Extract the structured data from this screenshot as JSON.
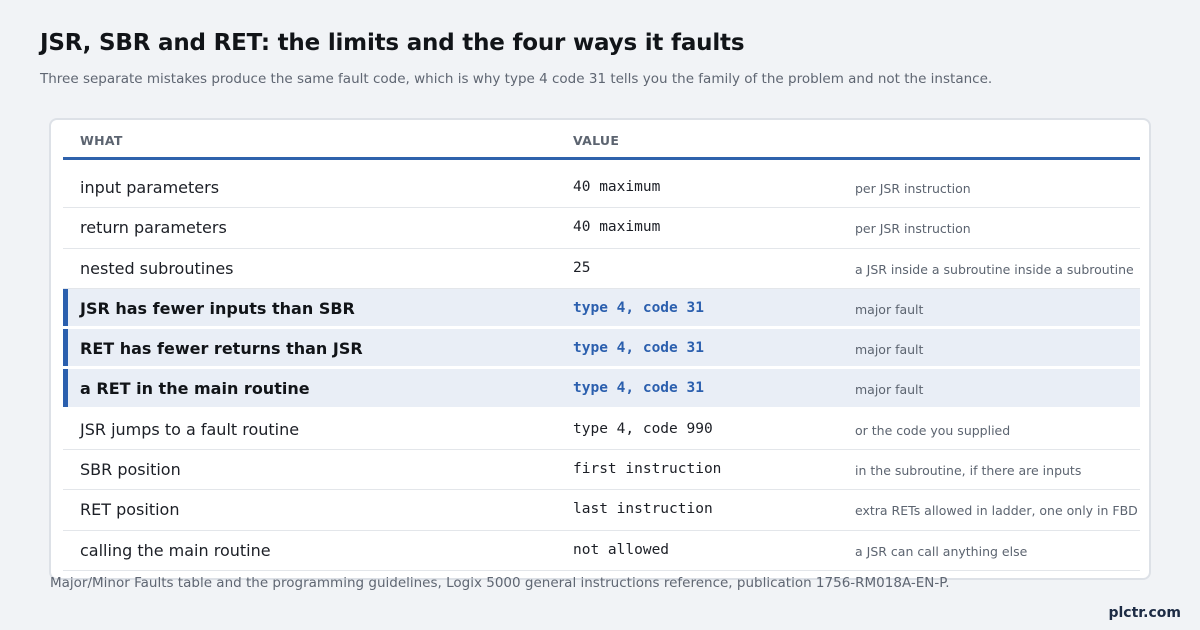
{
  "header": {
    "title": "JSR, SBR and RET: the limits and the four ways it faults",
    "subtitle": "Three separate mistakes produce the same fault code, which is why type 4 code 31 tells you the family of the problem and not the instance."
  },
  "table": {
    "columns": {
      "what": "WHAT",
      "value": "VALUE"
    },
    "rows": [
      {
        "what": "input parameters",
        "value": "40 maximum",
        "note": "per JSR instruction",
        "highlight": false
      },
      {
        "what": "return parameters",
        "value": "40 maximum",
        "note": "per JSR instruction",
        "highlight": false
      },
      {
        "what": "nested subroutines",
        "value": "25",
        "note": "a JSR inside a subroutine inside a subroutine",
        "highlight": false
      },
      {
        "what": "JSR has fewer inputs than SBR",
        "value": "type 4, code 31",
        "note": "major fault",
        "highlight": true
      },
      {
        "what": "RET has fewer returns than JSR",
        "value": "type 4, code 31",
        "note": "major fault",
        "highlight": true
      },
      {
        "what": "a RET in the main routine",
        "value": "type 4, code 31",
        "note": "major fault",
        "highlight": true
      },
      {
        "what": "JSR jumps to a fault routine",
        "value": "type 4, code 990",
        "note": "or the code you supplied",
        "highlight": false
      },
      {
        "what": "SBR position",
        "value": "first instruction",
        "note": "in the subroutine, if there are inputs",
        "highlight": false
      },
      {
        "what": "RET position",
        "value": "last instruction",
        "note": "extra RETs allowed in ladder, one only in FBD",
        "highlight": false
      },
      {
        "what": "calling the main routine",
        "value": "not allowed",
        "note": "a JSR can call anything else",
        "highlight": false
      }
    ]
  },
  "footer": {
    "source": "Major/Minor Faults table and the programming guidelines, Logix 5000 general instructions reference, publication 1756-RM018A-EN-P.",
    "brand": "plctr.com"
  },
  "colors": {
    "accent": "#2b5fae",
    "highlight_bg": "#e9eef6",
    "page_bg": "#f1f3f6"
  }
}
